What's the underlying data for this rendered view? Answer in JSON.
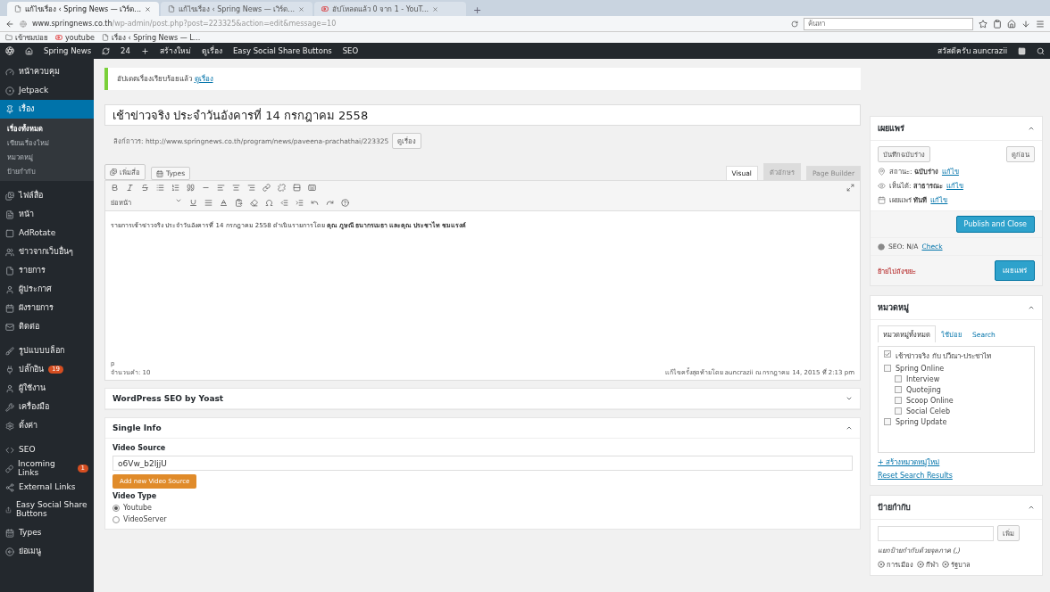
{
  "browser": {
    "tabs": [
      {
        "title": "แก้ไขเรื่อง ‹ Spring News — เวิร์ด...",
        "selected": true,
        "kind": "page"
      },
      {
        "title": "แก้ไขเรื่อง ‹ Spring News — เวิร์ด...",
        "selected": false,
        "kind": "page"
      },
      {
        "title": "อัปโหลดแล้ว 0 จาก 1 - YouT...",
        "selected": false,
        "kind": "video"
      }
    ],
    "new_tab": "+",
    "url_host": "www.springnews.co.th",
    "url_path": "/wp-admin/post.php?post=223325&action=edit&message=10",
    "search_placeholder": "ค้นหา",
    "bookmarks": [
      {
        "label": "เข้าชมบ่อย",
        "kind": "folder"
      },
      {
        "label": "youtube",
        "kind": "video"
      },
      {
        "label": "เรื่อง ‹ Spring News — L...",
        "kind": "page"
      }
    ]
  },
  "admin_bar": {
    "site": "Spring News",
    "updates": "24",
    "new": "สร้างใหม่",
    "items": [
      "ดูเรื่อง",
      "Easy Social Share Buttons",
      "SEO"
    ],
    "greeting": "สวัสดีครับ auncrazii"
  },
  "sidebar": {
    "items": [
      {
        "label": "หน้าควบคุม",
        "selected": false
      },
      {
        "label": "Jetpack",
        "selected": false
      },
      {
        "label": "เรื่อง",
        "selected": true,
        "children": [
          {
            "label": "เรื่องทั้งหมด",
            "selected": true
          },
          {
            "label": "เขียนเรื่องใหม่",
            "selected": false
          },
          {
            "label": "หมวดหมู่",
            "selected": false
          },
          {
            "label": "ป้ายกำกับ",
            "selected": false
          }
        ]
      },
      {
        "label": "ไฟล์สื่อ",
        "selected": false
      },
      {
        "label": "หน้า",
        "selected": false
      },
      {
        "label": "AdRotate",
        "selected": false
      },
      {
        "label": "ข่าวจากเว็บอื่นๆ",
        "selected": false
      },
      {
        "label": "รายการ",
        "selected": false
      },
      {
        "label": "ผู้ประกาศ",
        "selected": false
      },
      {
        "label": "ผังรายการ",
        "selected": false
      },
      {
        "label": "ติดต่อ",
        "selected": false
      },
      {
        "label": "รูปแบบบล็อก",
        "selected": false
      },
      {
        "label": "ปลั๊กอิน",
        "selected": false,
        "badge": "19"
      },
      {
        "label": "ผู้ใช้งาน",
        "selected": false
      },
      {
        "label": "เครื่องมือ",
        "selected": false
      },
      {
        "label": "ตั้งค่า",
        "selected": false
      },
      {
        "label": "SEO",
        "selected": false
      },
      {
        "label": "Incoming Links",
        "selected": false,
        "badge": "1"
      },
      {
        "label": "External Links",
        "selected": false
      },
      {
        "label": "Easy Social Share Buttons",
        "selected": false
      },
      {
        "label": "Types",
        "selected": false
      },
      {
        "label": "ย่อเมนู",
        "selected": false
      }
    ]
  },
  "notice": {
    "text": "อัปเดตเรื่องเรียบร้อยแล้ว",
    "link": "ดูเรื่อง"
  },
  "editor": {
    "title": "เช้าข่าวจริง ประจำวันอังคารที่ 14 กรกฎาคม 2558",
    "permalink_label": "ลิงก์ถาวร:",
    "permalink_url": "http://www.springnews.co.th/program/news/paveena-prachathai/223325",
    "permalink_button": "ดูเรื่อง",
    "media_buttons": [
      "เพิ่มสื่อ",
      "Types"
    ],
    "tabs": [
      {
        "label": "Visual",
        "selected": true
      },
      {
        "label": "ตัวอักษร",
        "selected": false
      },
      {
        "label": "Page Builder",
        "selected": false
      }
    ],
    "format_select": "ย่อหน้า",
    "content": "รายการเช้าข่าวจริง ประจำวันอังคารที่ 14 กรกฎาคม 2558  ดำเนินรายการโดย **คุณ ภูษณี ธนากรเมธา และคุณ ประชาไท ชมแรงค์**",
    "path": "p",
    "word_count": "จำนวนคำ: 10",
    "last_edited": "แก้ไขครั้งสุดท้ายโดย auncrazii ณ กรกฎาคม 14, 2015 ที่ 2:13 pm"
  },
  "seo_box": {
    "title": "WordPress SEO by Yoast"
  },
  "single_info": {
    "title": "Single Info",
    "video_source_label": "Video Source",
    "video_source_value": "o6Vw_b2IjjU",
    "add_button": "Add new Video Source",
    "video_type_label": "Video Type",
    "video_types": [
      {
        "label": "Youtube",
        "selected": true
      },
      {
        "label": "VideoServer",
        "selected": false
      }
    ]
  },
  "publish": {
    "title": "เผยแพร่",
    "save_draft": "บันทึกฉบับร่าง",
    "preview": "ดูก่อน",
    "rows": [
      {
        "kind": "status",
        "label": "สถานะ:",
        "value": "ฉบับร่าง",
        "link": "แก้ไข"
      },
      {
        "kind": "visibility",
        "label": "เห็นได้:",
        "value": "สาธารณะ",
        "link": "แก้ไข"
      },
      {
        "kind": "schedule",
        "label": "เผยแพร่",
        "value": "ทันที",
        "link": "แก้ไข"
      }
    ],
    "publish_close": "Publish and Close",
    "seo": "SEO: N/A",
    "seo_link": "Check",
    "trash": "ย้ายไปถังขยะ",
    "publish_button": "เผยแพร่"
  },
  "categories": {
    "title": "หมวดหมู่",
    "tabs": [
      {
        "label": "หมวดหมู่ทั้งหมด",
        "selected": true
      },
      {
        "label": "ใช้บ่อย",
        "selected": false
      },
      {
        "label": "Search",
        "selected": false
      }
    ],
    "items": [
      {
        "label": "เช้าข่าวจริง กับ ปวีณา-ประชาไท",
        "checked": true
      },
      {
        "label": "Spring Online",
        "checked": false,
        "children": [
          {
            "label": "Interview",
            "checked": false
          },
          {
            "label": "Quotejing",
            "checked": false
          },
          {
            "label": "Scoop Online",
            "checked": false
          },
          {
            "label": "Social Celeb",
            "checked": false
          }
        ]
      },
      {
        "label": "Spring Update",
        "checked": false
      }
    ],
    "add_link": "+ สร้างหมวดหมู่ใหม่",
    "reset_link": "Reset Search Results"
  },
  "tags": {
    "title": "ป้ายกำกับ",
    "add": "เพิ่ม",
    "hint": "แยกป้ายกำกับด้วยจุลภาค (,)",
    "items": [
      "การเมือง",
      "กีฬา",
      "รัฐบาล"
    ]
  }
}
